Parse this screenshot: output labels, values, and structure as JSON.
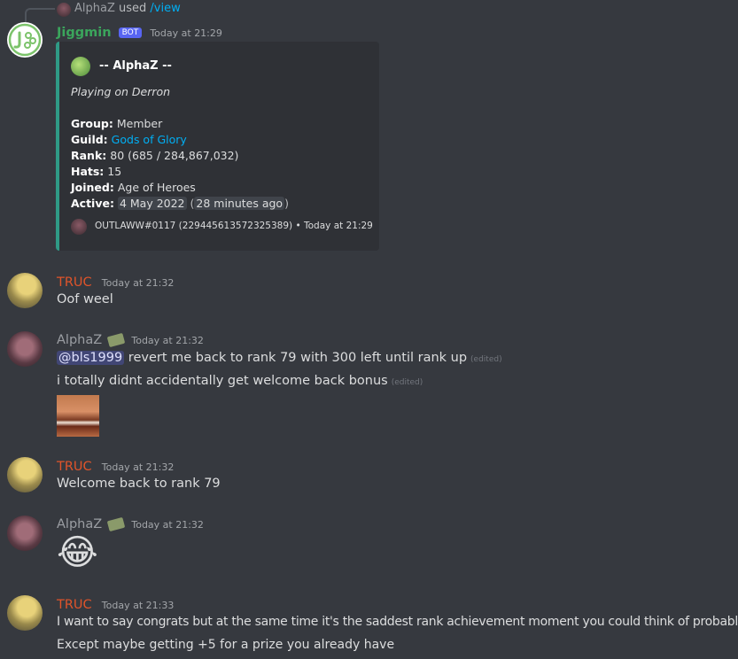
{
  "reply": {
    "user": "AlphaZ",
    "used": "used",
    "command": "/view"
  },
  "bot_message": {
    "author": "Jiggmin",
    "badge": "BOT",
    "timestamp": "Today at 21:29",
    "embed": {
      "title": "-- AlphaZ --",
      "subtitle": "Playing on Derron",
      "fields": [
        {
          "label": "Group:",
          "value": "Member"
        },
        {
          "label": "Guild:",
          "value": "Gods of Glory"
        },
        {
          "label": "Rank:",
          "value": "80 (685 / 284,867,032)"
        },
        {
          "label": "Hats:",
          "value": "15"
        },
        {
          "label": "Joined:",
          "value": "Age of Heroes"
        },
        {
          "label": "Active:",
          "value": "4 May 2022",
          "extra": "28 minutes ago"
        }
      ],
      "footer": "OUTLAWW#0117 (229445613572325389) • Today at 21:29",
      "accent_color": "#2f9a86"
    }
  },
  "messages": [
    {
      "author": "TRUC",
      "timestamp": "Today at 21:32",
      "text": "Oof weel"
    },
    {
      "author": "AlphaZ",
      "timestamp": "Today at 21:32",
      "mention": "@bls1999",
      "text": " revert me back to rank 79 with 300 left until rank up",
      "edited": "(edited)"
    },
    {
      "author": "AlphaZ",
      "text": "i totally didnt accidentally get welcome back bonus",
      "edited": "(edited)"
    },
    {
      "author": "TRUC",
      "timestamp": "Today at 21:32",
      "text": "Welcome back to rank 79"
    },
    {
      "author": "AlphaZ",
      "timestamp": "Today at 21:32",
      "emoji": "😂"
    },
    {
      "author": "TRUC",
      "timestamp": "Today at 21:33",
      "text": "I want to say congrats but at the same time it's the saddest rank achievement moment you could think of probably"
    },
    {
      "author": "TRUC",
      "text": "Except maybe getting +5 for a prize you already have"
    }
  ],
  "colors": {
    "background": "#36393f",
    "truc": "#e0542a",
    "jiggmin": "#3ba55c",
    "bot_badge": "#5865f2",
    "link": "#00aff4"
  }
}
